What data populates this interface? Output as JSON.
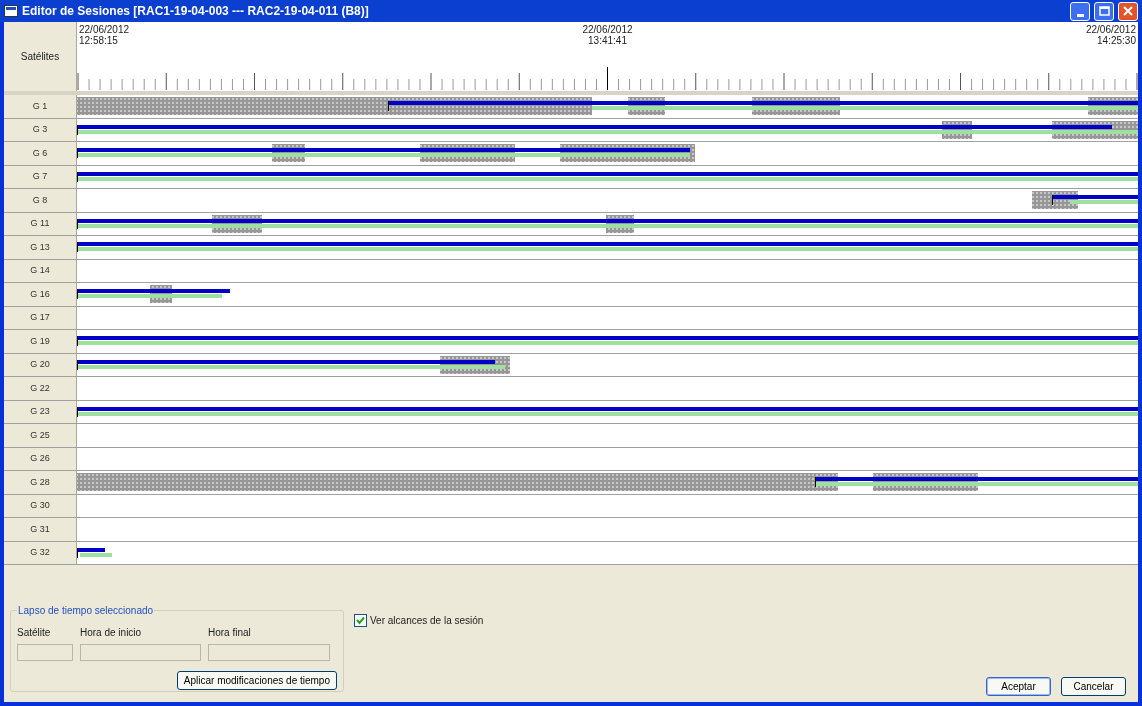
{
  "window": {
    "title": "Editor de Sesiones [RAC1-19-04-003 --- RAC2-19-04-011 (B8)]"
  },
  "timeline": {
    "header_label": "Satélites",
    "time_marks": [
      {
        "date": "22/06/2012",
        "time": "12:58:15"
      },
      {
        "date": "22/06/2012",
        "time": "13:41:41"
      },
      {
        "date": "22/06/2012",
        "time": "14:25:30"
      }
    ],
    "rows": [
      {
        "label": "G 1"
      },
      {
        "label": "G 3"
      },
      {
        "label": "G 6"
      },
      {
        "label": "G 7"
      },
      {
        "label": "G 8"
      },
      {
        "label": "G 11"
      },
      {
        "label": "G 13"
      },
      {
        "label": "G 14"
      },
      {
        "label": "G 16"
      },
      {
        "label": "G 17"
      },
      {
        "label": "G 19"
      },
      {
        "label": "G 20"
      },
      {
        "label": "G 22"
      },
      {
        "label": "G 23"
      },
      {
        "label": "G 25"
      },
      {
        "label": "G 26"
      },
      {
        "label": "G 28"
      },
      {
        "label": "G 30"
      },
      {
        "label": "G 31"
      },
      {
        "label": "G 32"
      }
    ]
  },
  "selection": {
    "title": "Lapso de tiempo seleccionado",
    "fields": [
      {
        "label": "Satélite"
      },
      {
        "label": "Hora de inicio"
      },
      {
        "label": "Hora final"
      }
    ],
    "apply_button": "Aplicar modificaciones de tiempo"
  },
  "show_ranges": {
    "label": "Ver alcances de la sesión",
    "checked": true
  },
  "buttons": [
    "Aceptar",
    "Cancelar"
  ]
}
